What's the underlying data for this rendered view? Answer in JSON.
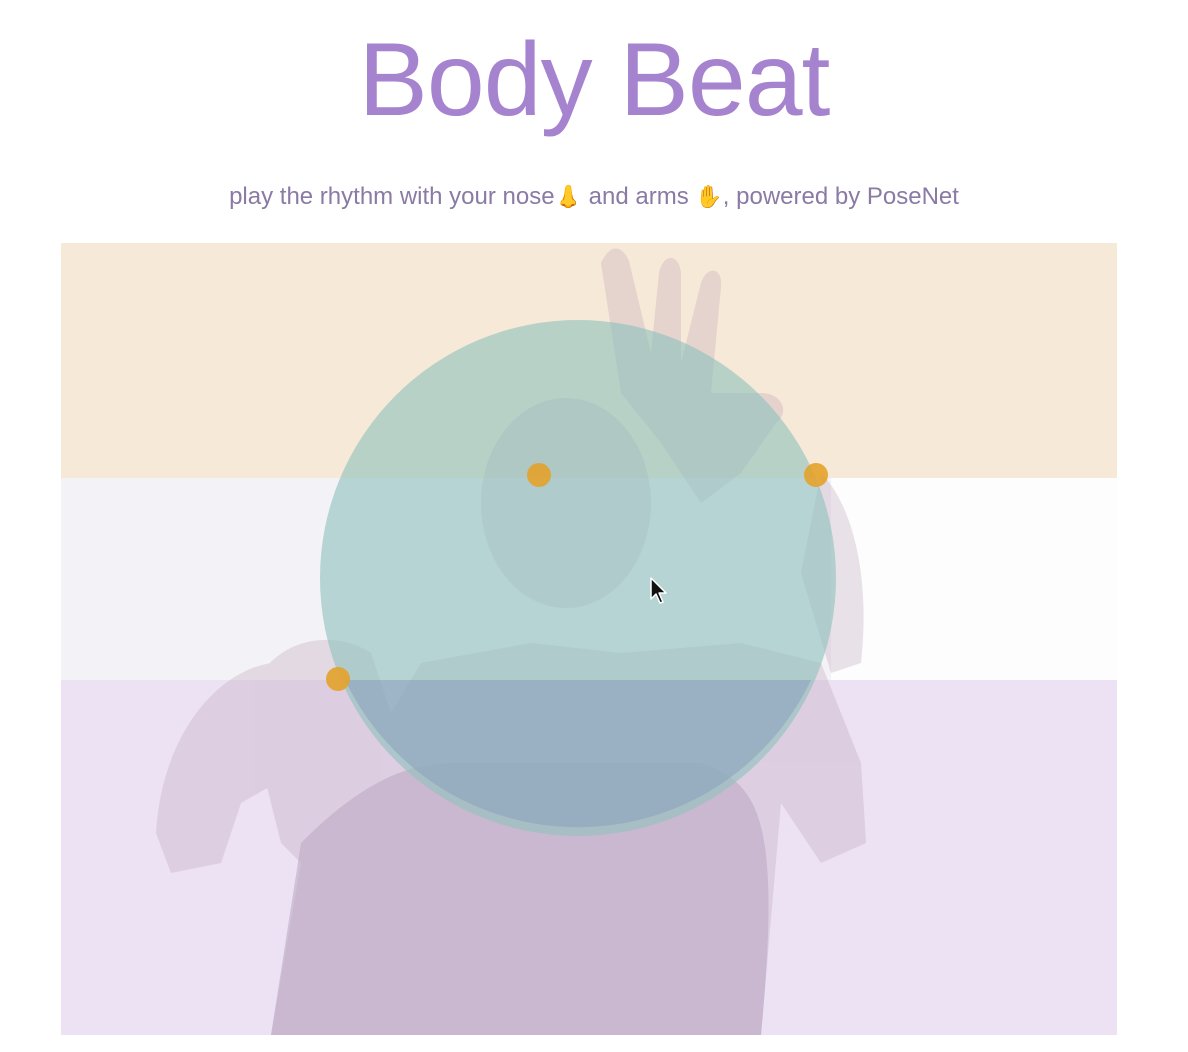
{
  "header": {
    "title": "Body Beat",
    "subtitle_part1": "play the rhythm with your nose",
    "subtitle_emoji1": "nose-emoji",
    "subtitle_part2": " and arms",
    "subtitle_emoji2": "hand-emoji",
    "subtitle_part3": ", powered by PoseNet"
  },
  "colors": {
    "title": "#a583cf",
    "zone_top": "#f7e9d8",
    "zone_middle": "#f3f2f6",
    "zone_bottom": "#ece2f4",
    "pulse_circle": "#8fc2bd",
    "keypoint": "#e3a22b"
  },
  "icons": {
    "cursor": "mouse-pointer-icon"
  }
}
